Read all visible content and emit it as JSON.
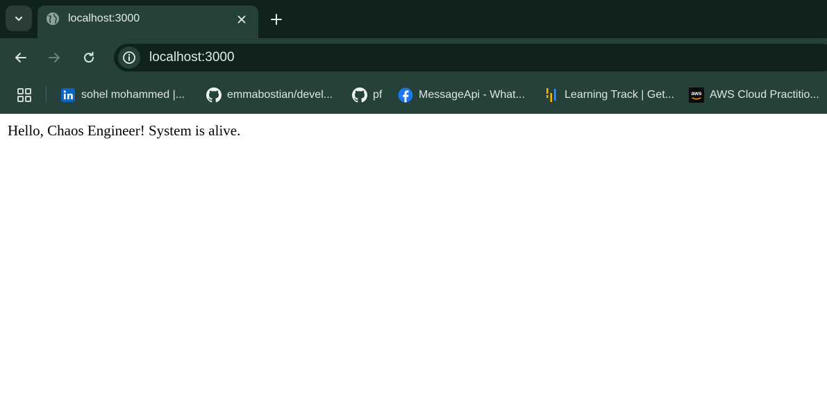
{
  "tab": {
    "title": "localhost:3000",
    "favicon": "globe-icon"
  },
  "toolbar": {
    "back": "arrow-left-icon",
    "forward": "arrow-right-icon",
    "reload": "reload-icon"
  },
  "address_bar": {
    "url": "localhost:3000",
    "site_info_icon": "info-icon"
  },
  "bookmarks": [
    {
      "label": "sohel mohammed |...",
      "icon": "linkedin-icon"
    },
    {
      "label": "emmabostian/devel...",
      "icon": "github-icon"
    },
    {
      "label": "pf",
      "icon": "github-icon"
    },
    {
      "label": "MessageApi - What...",
      "icon": "facebook-icon"
    },
    {
      "label": "Learning Track | Get...",
      "icon": "learning-track-icon"
    },
    {
      "label": "AWS Cloud Practitio...",
      "icon": "aws-icon"
    }
  ],
  "page": {
    "message": "Hello, Chaos Engineer! System is alive."
  },
  "colors": {
    "tab_strip": "#0f221c",
    "toolbar": "#26403a",
    "linkedin": "#0a66c2",
    "facebook": "#1877f2",
    "learning_track": "#f5b800",
    "aws_orange": "#ff9900"
  }
}
